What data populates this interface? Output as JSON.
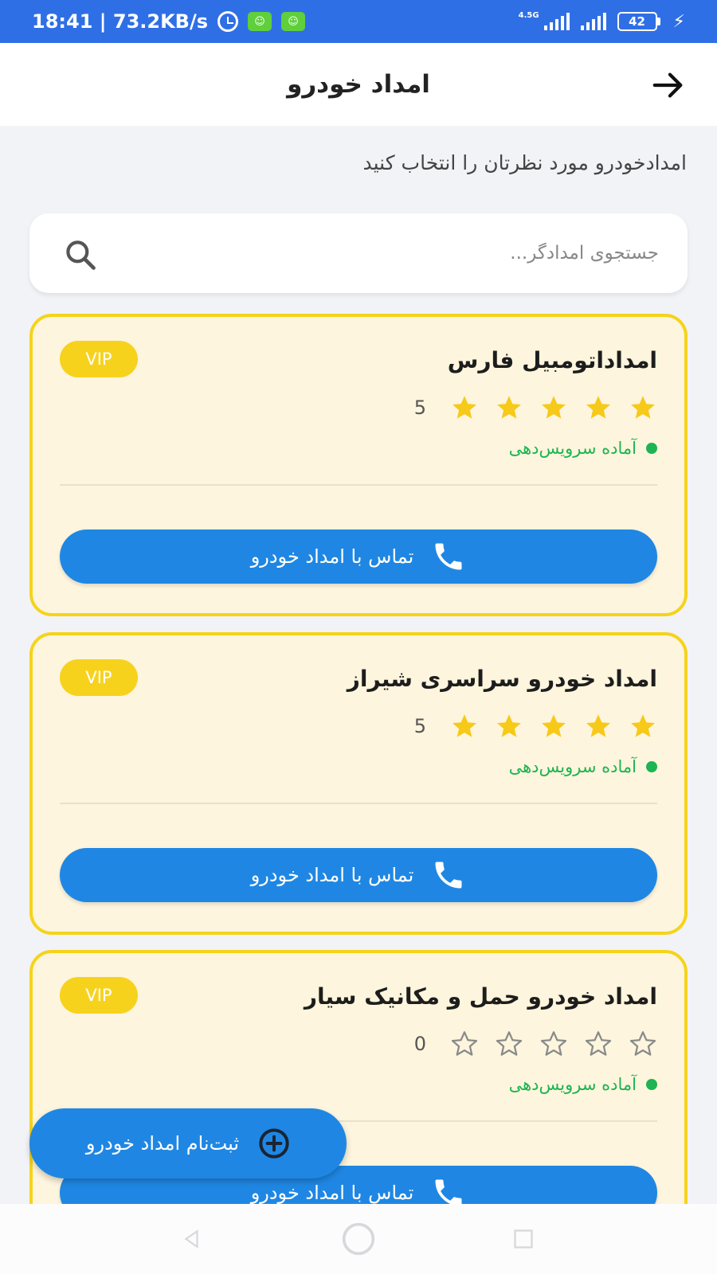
{
  "status_bar": {
    "time_speed": "18:41 | 73.2KB/s",
    "network_label": "4.5G",
    "battery": "42"
  },
  "app_bar": {
    "title": "امداد خودرو",
    "back_icon": "arrow-right-icon"
  },
  "subtitle": "امدادخودرو مورد نظرتان را انتخاب کنید",
  "search": {
    "placeholder": "جستجوی امدادگر...",
    "value": "",
    "icon": "search-icon"
  },
  "cards": [
    {
      "badge": "VIP",
      "title": "امداداتومبیل فارس",
      "rating": 5,
      "rating_label": "5",
      "status": "آماده سرویس‌دهی",
      "button": "تماس با امداد خودرو"
    },
    {
      "badge": "VIP",
      "title": "امداد خودرو سراسری شیراز",
      "rating": 5,
      "rating_label": "5",
      "status": "آماده سرویس‌دهی",
      "button": "تماس با امداد خودرو"
    },
    {
      "badge": "VIP",
      "title": "امداد خودرو حمل و مکانیک سیار",
      "rating": 0,
      "rating_label": "0",
      "status": "آماده سرویس‌دهی",
      "button": "تماس با امداد خودرو"
    }
  ],
  "fab": {
    "label": "ثبت‌نام امداد خودرو",
    "icon": "plus-circle-icon"
  },
  "colors": {
    "primary": "#1f87e3",
    "status_bar": "#2f6fe6",
    "vip": "#f7d21d",
    "card_bg": "#fdf5dd",
    "star": "#f7c918",
    "ready": "#1db451"
  }
}
